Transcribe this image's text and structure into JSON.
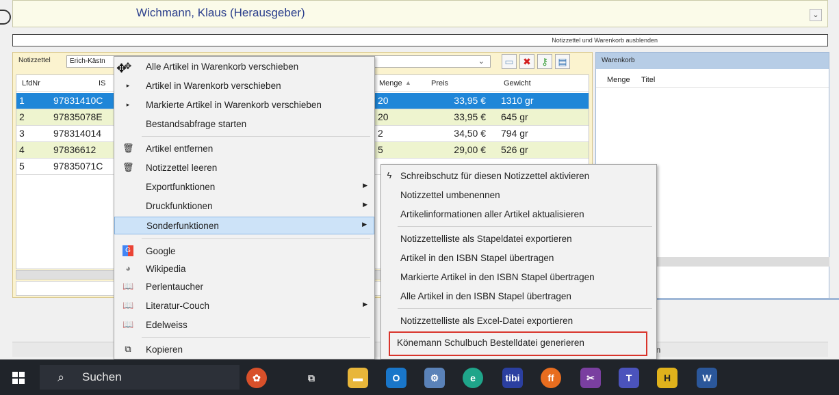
{
  "header": {
    "author": "Wichmann, Klaus (Herausgeber)"
  },
  "toggle_label": "Notizzettel und Warenkorb ausblenden",
  "notiz": {
    "label": "Notizzettel",
    "combo_value": "Erich-Kästn"
  },
  "grid": {
    "columns": [
      "LfdNr",
      "IS",
      "Menge",
      "Preis",
      "Gewicht"
    ],
    "rows": [
      {
        "nr": "1",
        "isbn": "97831410C",
        "menge": "20",
        "preis": "33,95 €",
        "gewicht": "1310 gr"
      },
      {
        "nr": "2",
        "isbn": "97835078E",
        "menge": "20",
        "preis": "33,95 €",
        "gewicht": "645 gr"
      },
      {
        "nr": "3",
        "isbn": "97831401⁠4",
        "menge": "2",
        "preis": "34,50 €",
        "gewicht": "794 gr"
      },
      {
        "nr": "4",
        "isbn": "97836612",
        "menge": "5",
        "preis": "29,00 €",
        "gewicht": "526 gr"
      },
      {
        "nr": "5",
        "isbn": "97835071C",
        "menge": "",
        "preis": "",
        "gewicht": ""
      }
    ]
  },
  "warenkorb": {
    "title": "Warenkorb",
    "columns": [
      "Menge",
      "Titel"
    ]
  },
  "bottom_fragment": "en",
  "context_menu": {
    "items": [
      {
        "label": "Alle Artikel in Warenkorb verschieben",
        "icon": "move-icon"
      },
      {
        "label": "Artikel in Warenkorb verschieben",
        "icon": "bullet-icon"
      },
      {
        "label": "Markierte Artikel in Warenkorb verschieben",
        "icon": "bullet-icon"
      },
      {
        "label": "Bestandsabfrage starten",
        "icon": ""
      },
      {
        "label": "Artikel entfernen",
        "icon": "trash-icon"
      },
      {
        "label": "Notizzettel leeren",
        "icon": "trash-icon"
      },
      {
        "label": "Exportfunktionen",
        "icon": "",
        "submenu": true
      },
      {
        "label": "Druckfunktionen",
        "icon": "",
        "submenu": true
      },
      {
        "label": "Sonderfunktionen",
        "icon": "",
        "submenu": true,
        "highlighted": true
      },
      {
        "label": "Google",
        "icon": "google-icon"
      },
      {
        "label": "Wikipedia",
        "icon": "wikipedia-icon"
      },
      {
        "label": "Perlentaucher",
        "icon": "book-icon"
      },
      {
        "label": "Literatur-Couch",
        "icon": "book-icon",
        "submenu": true
      },
      {
        "label": "Edelweiss",
        "icon": "book-icon"
      },
      {
        "label": "Kopieren",
        "icon": "copy-icon"
      }
    ]
  },
  "submenu": {
    "items": [
      {
        "label": "Schreibschutz für diesen Notizzettel aktivieren",
        "icon": "lightning-icon"
      },
      {
        "label": "Notizzettel umbenennen"
      },
      {
        "label": "Artikelinformationen aller Artikel aktualisieren"
      },
      {
        "label": "Notizzettelliste als Stapeldatei exportieren"
      },
      {
        "label": "Artikel in den ISBN Stapel übertragen"
      },
      {
        "label": "Markierte Artikel in den ISBN Stapel übertragen"
      },
      {
        "label": "Alle Artikel in den ISBN Stapel übertragen"
      },
      {
        "label": "Notizzettelliste als Excel-Datei exportieren"
      },
      {
        "label": "Könemann Schulbuch Bestelldatei generieren",
        "highlighted_red": true
      }
    ]
  },
  "taskbar": {
    "search_label": "Suchen",
    "apps": [
      "flower-app-icon",
      "task-view-icon",
      "file-explorer-icon",
      "outlook-icon",
      "network-app-icon",
      "edge-icon",
      "tibi-icon",
      "firefox-icon",
      "tools-app-icon",
      "teams-icon",
      "h-app-icon",
      "word-icon"
    ]
  },
  "colors": {
    "selection": "#1f86d8",
    "notiz_bg": "#fbf3cf",
    "warenkorb_header": "#b7cde6",
    "menu_highlight": "#cde3f8",
    "red_box": "#d9342b",
    "taskbar": "#20242a"
  }
}
